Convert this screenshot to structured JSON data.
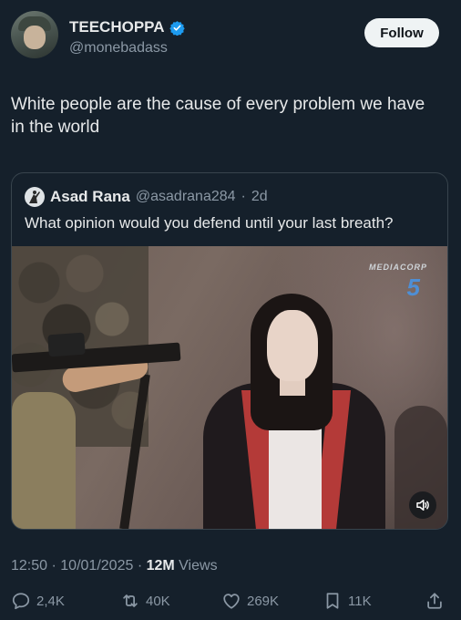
{
  "author": {
    "display_name": "TEECHOPPA",
    "handle": "@monebadass",
    "follow_label": "Follow"
  },
  "tweet": {
    "text": "White people are the cause of every problem we have in the world"
  },
  "quote": {
    "display_name": "Asad Rana",
    "handle": "@asadrana284",
    "separator": "·",
    "time": "2d",
    "text": "What opinion would you defend until your last breath?",
    "media": {
      "watermark_text": "MEDIACORP",
      "watermark_number": "5",
      "mute_icon": "speaker-icon"
    }
  },
  "meta": {
    "time": "12:50",
    "separator": "·",
    "date": "10/01/2025",
    "views_count": "12M",
    "views_label": "Views"
  },
  "actions": {
    "replies": "2,4K",
    "reposts": "40K",
    "likes": "269K",
    "bookmarks": "11K"
  },
  "colors": {
    "background": "#15202b",
    "text_primary": "#e7e9ea",
    "text_secondary": "#8b98a5",
    "verified": "#1d9bf0",
    "border": "#38444d"
  }
}
